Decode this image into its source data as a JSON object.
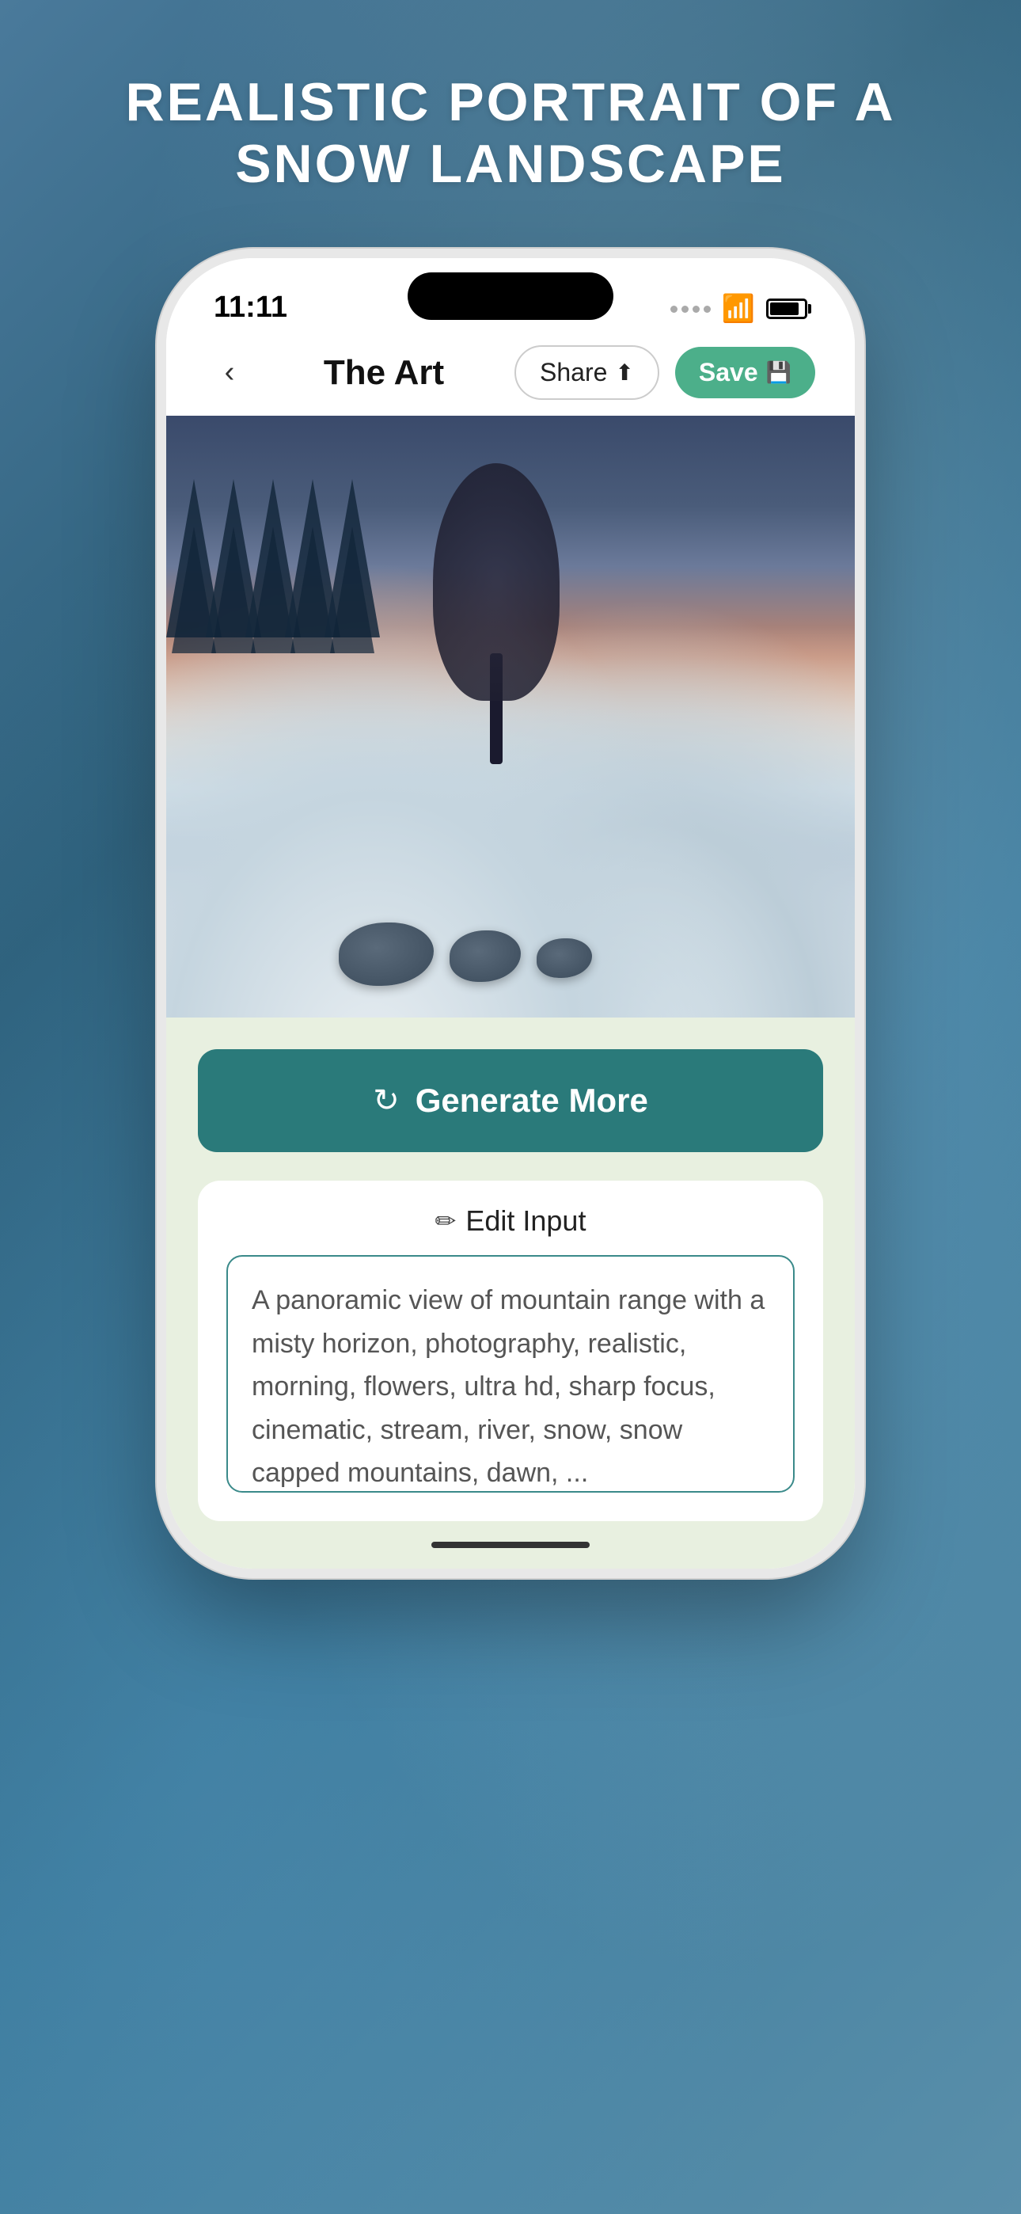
{
  "page": {
    "title": "REALISTIC PORTRAIT OF A\nSNOW LANDSCAPE"
  },
  "status_bar": {
    "time": "11:11",
    "signal": "signal",
    "wifi": "wifi",
    "battery": "battery"
  },
  "nav": {
    "back_label": "‹",
    "title": "The Art",
    "share_label": "Share",
    "save_label": "Save"
  },
  "actions": {
    "generate_label": "Generate More",
    "edit_label": "Edit Input"
  },
  "input_text": {
    "value": "A panoramic view of mountain range with a misty horizon, photography, realistic, morning, flowers, ultra hd, sharp focus, cinematic, stream, river, snow, snow capped mountains, dawn, ..."
  },
  "colors": {
    "background_gradient_start": "#4a7a9b",
    "background_gradient_end": "#2c5f7a",
    "generate_button": "#2a7a7a",
    "save_button": "#4caf8a",
    "input_border": "#3a8a8a",
    "content_bg": "#e8f0e0"
  }
}
